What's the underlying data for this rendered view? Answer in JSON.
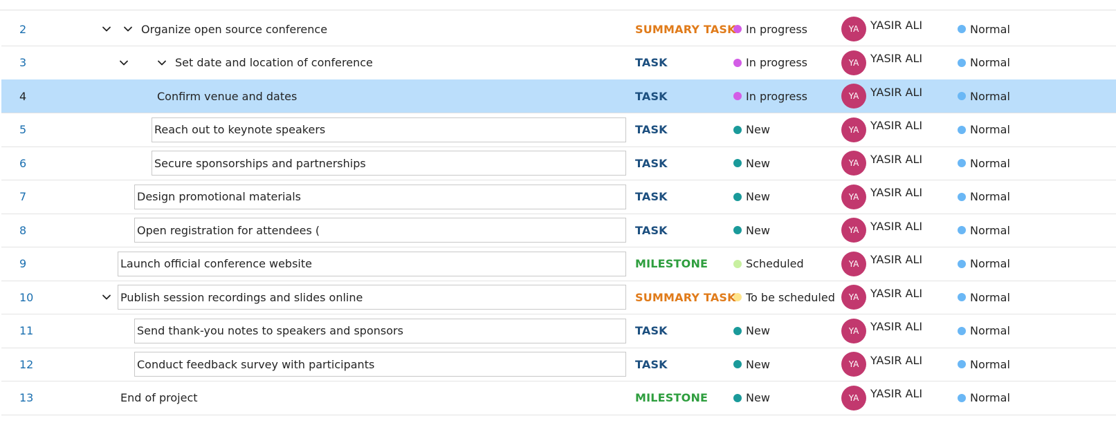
{
  "colors": {
    "summary_task": "#e07b1a",
    "task": "#1c4f7f",
    "milestone": "#2e9e3e",
    "in_progress_dot": "#d35de6",
    "new_dot": "#1a9a9a",
    "scheduled_dot": "#c8f0a0",
    "to_be_scheduled_dot": "#ffe48a",
    "normal_dot": "#6ab7f5",
    "avatar_bg": "#c2386e",
    "selected_row": "#bbdefb"
  },
  "rows": [
    {
      "id": "2",
      "subject": "Organize open source conference",
      "type": "SUMMARY TASK",
      "type_color": "summary_task",
      "status": "In progress",
      "status_color": "in_progress_dot",
      "assignee_initials": "YA",
      "assignee": "YASIR ALI",
      "priority": "Normal",
      "chevrons": [
        "chevron-down-icon",
        "chevron-down-icon"
      ],
      "boxed": false
    },
    {
      "id": "3",
      "subject": "Set date and location of conference",
      "type": "TASK",
      "type_color": "task",
      "status": "In progress",
      "status_color": "in_progress_dot",
      "assignee_initials": "YA",
      "assignee": "YASIR ALI",
      "priority": "Normal",
      "chevrons": [
        "chevron-down-icon",
        "chevron-down-icon"
      ],
      "boxed": false
    },
    {
      "id": "4",
      "subject": "Confirm venue and dates",
      "type": "TASK",
      "type_color": "task",
      "status": "In progress",
      "status_color": "in_progress_dot",
      "assignee_initials": "YA",
      "assignee": "YASIR ALI",
      "priority": "Normal",
      "chevrons": [],
      "boxed": false,
      "selected": true
    },
    {
      "id": "5",
      "subject": "Reach out to keynote speakers",
      "type": "TASK",
      "type_color": "task",
      "status": "New",
      "status_color": "new_dot",
      "assignee_initials": "YA",
      "assignee": "YASIR ALI",
      "priority": "Normal",
      "chevrons": [],
      "boxed": true
    },
    {
      "id": "6",
      "subject": "Secure sponsorships and partnerships",
      "type": "TASK",
      "type_color": "task",
      "status": "New",
      "status_color": "new_dot",
      "assignee_initials": "YA",
      "assignee": "YASIR ALI",
      "priority": "Normal",
      "chevrons": [],
      "boxed": true
    },
    {
      "id": "7",
      "subject": "Design promotional materials",
      "type": "TASK",
      "type_color": "task",
      "status": "New",
      "status_color": "new_dot",
      "assignee_initials": "YA",
      "assignee": "YASIR ALI",
      "priority": "Normal",
      "chevrons": [],
      "boxed": true
    },
    {
      "id": "8",
      "subject": "Open registration for attendees (",
      "type": "TASK",
      "type_color": "task",
      "status": "New",
      "status_color": "new_dot",
      "assignee_initials": "YA",
      "assignee": "YASIR ALI",
      "priority": "Normal",
      "chevrons": [],
      "boxed": true
    },
    {
      "id": "9",
      "subject": "Launch official conference website",
      "type": "MILESTONE",
      "type_color": "milestone",
      "status": "Scheduled",
      "status_color": "scheduled_dot",
      "assignee_initials": "YA",
      "assignee": "YASIR ALI",
      "priority": "Normal",
      "chevrons": [],
      "boxed": true
    },
    {
      "id": "10",
      "subject": "Publish session recordings and slides online",
      "type": "SUMMARY TASK",
      "type_color": "summary_task",
      "status": "To be scheduled",
      "status_color": "to_be_scheduled_dot",
      "assignee_initials": "YA",
      "assignee": "YASIR ALI",
      "priority": "Normal",
      "chevrons": [
        "chevron-down-icon"
      ],
      "boxed": true
    },
    {
      "id": "11",
      "subject": "Send thank-you notes to speakers and sponsors",
      "type": "TASK",
      "type_color": "task",
      "status": "New",
      "status_color": "new_dot",
      "assignee_initials": "YA",
      "assignee": "YASIR ALI",
      "priority": "Normal",
      "chevrons": [],
      "boxed": true
    },
    {
      "id": "12",
      "subject": "Conduct feedback survey with participants",
      "type": "TASK",
      "type_color": "task",
      "status": "New",
      "status_color": "new_dot",
      "assignee_initials": "YA",
      "assignee": "YASIR ALI",
      "priority": "Normal",
      "chevrons": [],
      "boxed": true
    },
    {
      "id": "13",
      "subject": "End of project",
      "type": "MILESTONE",
      "type_color": "milestone",
      "status": "New",
      "status_color": "new_dot",
      "assignee_initials": "YA",
      "assignee": "YASIR ALI",
      "priority": "Normal",
      "chevrons": [],
      "boxed": false
    }
  ]
}
